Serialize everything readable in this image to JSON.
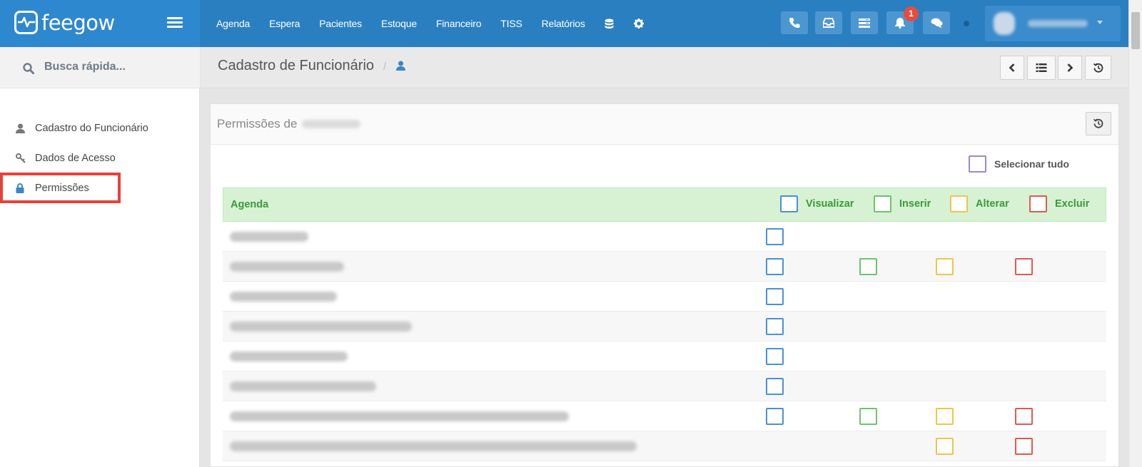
{
  "brand": {
    "name": "feegow"
  },
  "nav": {
    "items": [
      "Agenda",
      "Espera",
      "Pacientes",
      "Estoque",
      "Financeiro",
      "TISS",
      "Relatórios"
    ]
  },
  "topbar": {
    "icons": [
      "phone-icon",
      "inbox-icon",
      "panel-icon",
      "bell-icon",
      "chat-icon"
    ],
    "notifications_count": "1"
  },
  "sidebar": {
    "search_placeholder": "Busca rápida...",
    "items": [
      {
        "label": "Cadastro do Funcionário",
        "icon": "user-icon"
      },
      {
        "label": "Dados de Acesso",
        "icon": "key-icon"
      },
      {
        "label": "Permissões",
        "icon": "lock-icon",
        "active": true
      }
    ]
  },
  "header": {
    "title": "Cadastro de Funcionário",
    "separator": "/"
  },
  "panel": {
    "title": "Permissões de",
    "select_all_label": "Selecionar tudo",
    "section": "Agenda",
    "columns": [
      "Visualizar",
      "Inserir",
      "Alterar",
      "Excluir"
    ],
    "rows": [
      {
        "cells": [
          true,
          false,
          false,
          false
        ]
      },
      {
        "cells": [
          true,
          true,
          true,
          true
        ]
      },
      {
        "cells": [
          true,
          false,
          false,
          false
        ]
      },
      {
        "cells": [
          true,
          false,
          false,
          false
        ]
      },
      {
        "cells": [
          true,
          false,
          false,
          false
        ]
      },
      {
        "cells": [
          true,
          false,
          false,
          false
        ]
      },
      {
        "cells": [
          true,
          true,
          true,
          true
        ]
      },
      {
        "cells": [
          false,
          false,
          true,
          true
        ]
      }
    ]
  },
  "colors": {
    "topbar": "#2a7fc1",
    "brand": "#2e88d0",
    "visualizar": "#4a90d9",
    "inserir": "#6cc46c",
    "alterar": "#f0c34e",
    "excluir": "#e05a4a",
    "highlight": "#e8413a"
  }
}
